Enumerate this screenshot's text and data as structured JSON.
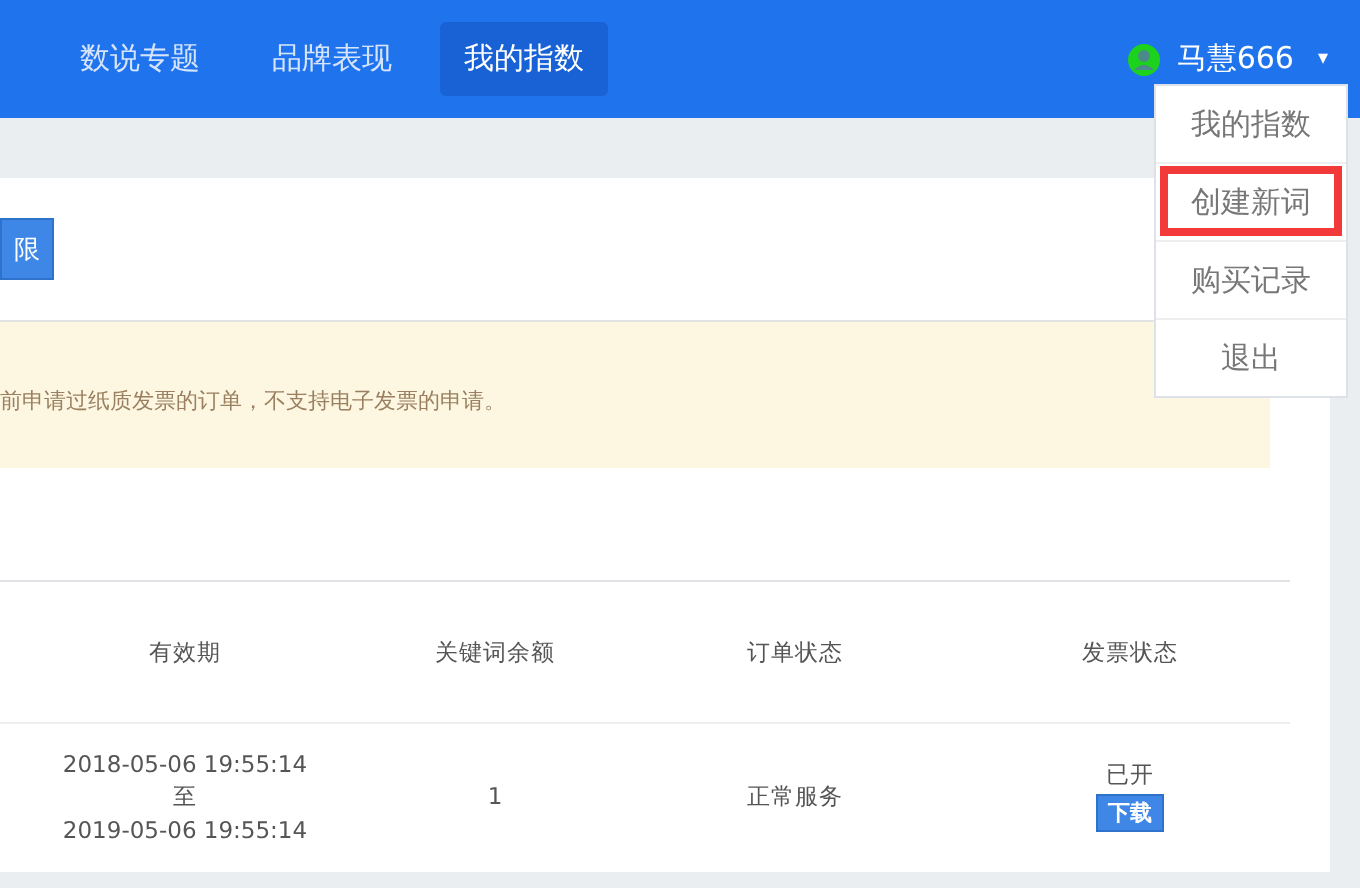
{
  "nav": {
    "tabs": [
      {
        "label": "数说专题",
        "selected": false
      },
      {
        "label": "品牌表现",
        "selected": false
      },
      {
        "label": "我的指数",
        "selected": true
      }
    ],
    "user": {
      "name": "马慧666",
      "caret": "▾"
    }
  },
  "user_menu": {
    "items": [
      {
        "label": "我的指数",
        "highlighted": false
      },
      {
        "label": "创建新词",
        "highlighted": true
      },
      {
        "label": "购买记录",
        "highlighted": false
      },
      {
        "label": "退出",
        "highlighted": false
      }
    ]
  },
  "toolbar": {
    "button": "限"
  },
  "notice": "前申请过纸质发票的订单，不支持电子发票的申请。",
  "table": {
    "columns": [
      "有效期",
      "关键词余额",
      "订单状态",
      "发票状态"
    ],
    "rows": [
      {
        "validity_start": "2018-05-06 19:55:14",
        "validity_to": "至",
        "validity_end": "2019-05-06 19:55:14",
        "keyword_balance": "1",
        "order_status": "正常服务",
        "invoice_status": "已开",
        "invoice_action": "下载"
      }
    ]
  }
}
